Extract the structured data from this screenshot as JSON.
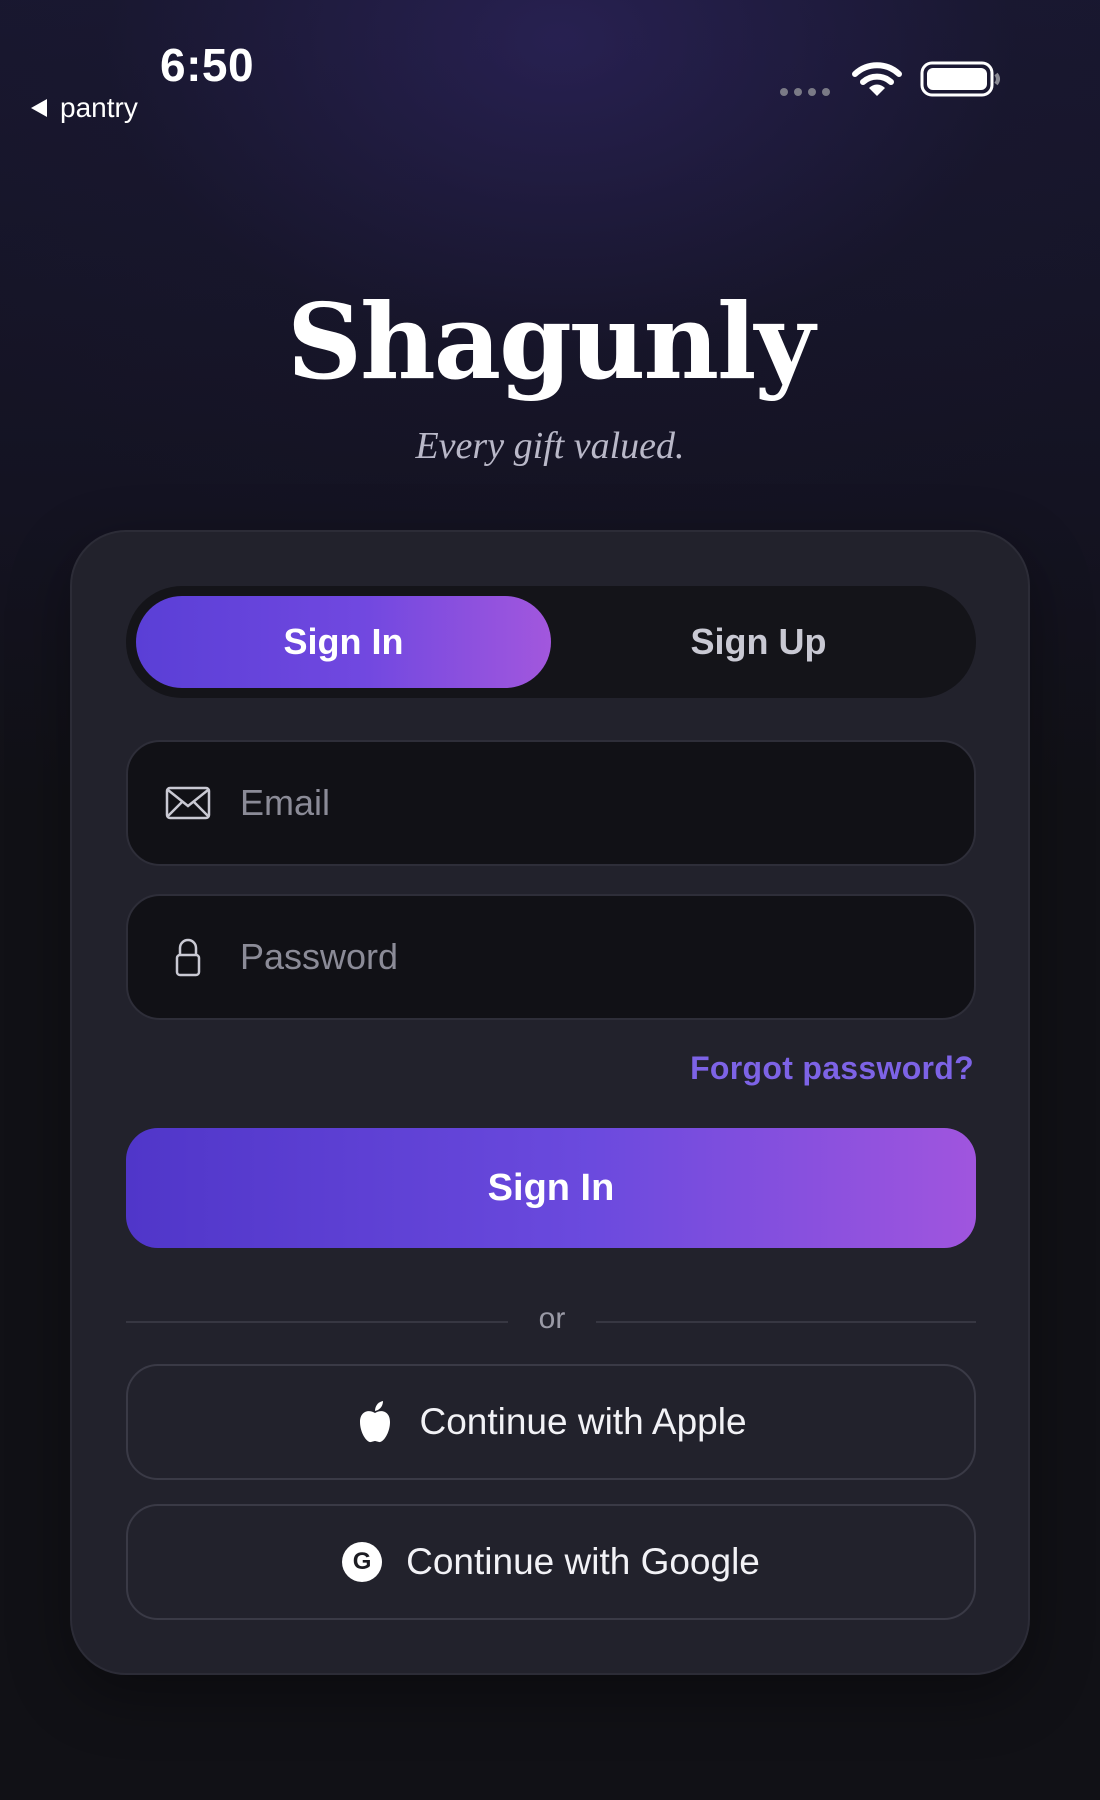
{
  "status_bar": {
    "time": "6:50",
    "back_label": "pantry",
    "icons": [
      "signal-dots-icon",
      "wifi-icon",
      "battery-icon"
    ]
  },
  "brand": {
    "title": "Shagunly",
    "tagline": "Every gift valued."
  },
  "auth_tabs": {
    "sign_in": "Sign In",
    "sign_up": "Sign Up",
    "active": "sign_in"
  },
  "form": {
    "email_placeholder": "Email",
    "email_value": "",
    "password_placeholder": "Password",
    "password_value": "",
    "forgot_label": "Forgot password?",
    "submit_label": "Sign In",
    "divider_label": "or"
  },
  "social": {
    "apple_label": "Continue with Apple",
    "google_label": "Continue with Google",
    "google_badge": "G"
  },
  "colors": {
    "accent_start": "#5a3fd6",
    "accent_end": "#a257dd",
    "link": "#7d63e6",
    "card": "#22222c",
    "background": "#111116"
  }
}
